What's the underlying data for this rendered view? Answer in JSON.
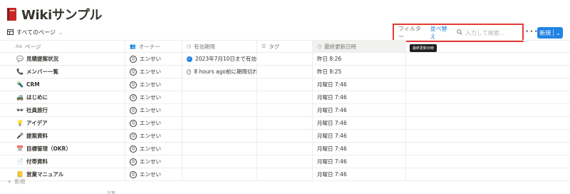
{
  "page": {
    "title": "Wikiサンプル",
    "title_icon": "book-icon"
  },
  "view": {
    "label": "すべてのページ",
    "chevron": "⌄"
  },
  "toolbar": {
    "filter_label": "フィルター",
    "sort_label": "並べ替え",
    "search_icon": "🔍",
    "search_placeholder": "入力して検索...",
    "more_label": "•••",
    "new_label": "新規",
    "new_chevron": "⌄"
  },
  "tooltip": {
    "text": "最終更新日時"
  },
  "columns": {
    "page": {
      "icon": "Aa",
      "label": "ページ"
    },
    "owner": {
      "icon": "👥",
      "label": "オーナー"
    },
    "due": {
      "icon": "◷",
      "label": "有効期限"
    },
    "tag": {
      "icon": "☰",
      "label": "タグ"
    },
    "updated": {
      "icon": "◷",
      "label": "最終更新日時"
    }
  },
  "rows": [
    {
      "emoji": "💬",
      "name": "見積提案状況",
      "owner": "エンせい",
      "due": "2023年7月10日まで有効",
      "due_status": "check",
      "tag": "",
      "updated": "昨日 8:26"
    },
    {
      "emoji": "📞",
      "name": "メンバー一覧",
      "owner": "エンせい",
      "due": "8 hours ago前に期限切れ",
      "due_status": "clock",
      "tag": "",
      "updated": "昨日 8:25"
    },
    {
      "emoji": "🔦",
      "name": "CRM",
      "owner": "エンせい",
      "due": "",
      "due_status": "",
      "tag": "",
      "updated": "月曜日 7:46"
    },
    {
      "emoji": "🚜",
      "name": "はじめに",
      "owner": "エンせい",
      "due": "",
      "due_status": "",
      "tag": "",
      "updated": "月曜日 7:46"
    },
    {
      "emoji": "🕶",
      "name": "社員旅行",
      "owner": "エンせい",
      "due": "",
      "due_status": "",
      "tag": "",
      "updated": "月曜日 7:46"
    },
    {
      "emoji": "💡",
      "name": "アイデア",
      "owner": "エンせい",
      "due": "",
      "due_status": "",
      "tag": "",
      "updated": "月曜日 7:46"
    },
    {
      "emoji": "🎤",
      "name": "提案資料",
      "owner": "エンせい",
      "due": "",
      "due_status": "",
      "tag": "",
      "updated": "月曜日 7:46"
    },
    {
      "emoji": "📅",
      "name": "目標管理（OKR）",
      "owner": "エンせい",
      "due": "",
      "due_status": "",
      "tag": "",
      "updated": "月曜日 7:46"
    },
    {
      "emoji": "📄",
      "name": "付帯資料",
      "owner": "エンせい",
      "due": "",
      "due_status": "",
      "tag": "",
      "updated": "月曜日 7:46"
    },
    {
      "emoji": "📒",
      "name": "営業マニュアル",
      "owner": "エンせい",
      "due": "",
      "due_status": "",
      "tag": "",
      "updated": "月曜日 7:46"
    }
  ],
  "new_row": {
    "icon": "+",
    "label": "新規"
  },
  "footer": {
    "partial": "計算"
  },
  "colors": {
    "accent": "#2383e2",
    "highlight": "#e53935",
    "text": "#37352f",
    "muted": "#787774"
  }
}
